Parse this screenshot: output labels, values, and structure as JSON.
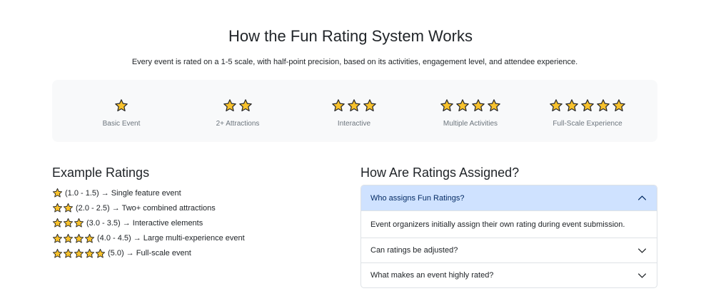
{
  "header": {
    "title": "How the Fun Rating System Works",
    "subtitle": "Every event is rated on a 1-5 scale, with half-point precision, based on its activities, engagement level, and attendee experience."
  },
  "scale": [
    {
      "stars": 1,
      "label": "Basic Event"
    },
    {
      "stars": 2,
      "label": "2+ Attractions"
    },
    {
      "stars": 3,
      "label": "Interactive"
    },
    {
      "stars": 4,
      "label": "Multiple Activities"
    },
    {
      "stars": 5,
      "label": "Full-Scale Experience"
    }
  ],
  "examples": {
    "title": "Example Ratings",
    "items": [
      {
        "stars": 1,
        "text": "(1.0 - 1.5) → Single feature event"
      },
      {
        "stars": 2,
        "text": "(2.0 - 2.5) → Two+ combined attractions"
      },
      {
        "stars": 3,
        "text": "(3.0 - 3.5) → Interactive elements"
      },
      {
        "stars": 4,
        "text": "(4.0 - 4.5) → Large multi-experience event"
      },
      {
        "stars": 5,
        "text": "(5.0) → Full-scale event"
      }
    ]
  },
  "faq": {
    "title": "How Are Ratings Assigned?",
    "items": [
      {
        "question": "Who assigns Fun Ratings?",
        "answer": "Event organizers initially assign their own rating during event submission.",
        "expanded": true
      },
      {
        "question": "Can ratings be adjusted?",
        "expanded": false
      },
      {
        "question": "What makes an event highly rated?",
        "expanded": false
      }
    ]
  },
  "colors": {
    "star_fill": "#f8c22c",
    "star_stroke": "#2b2b2b",
    "accordion_active_bg": "#cfe2ff",
    "card_bg": "#f8f9fa"
  },
  "icons": {
    "star": "star-icon",
    "chevron_up": "chevron-up-icon",
    "chevron_down": "chevron-down-icon"
  }
}
